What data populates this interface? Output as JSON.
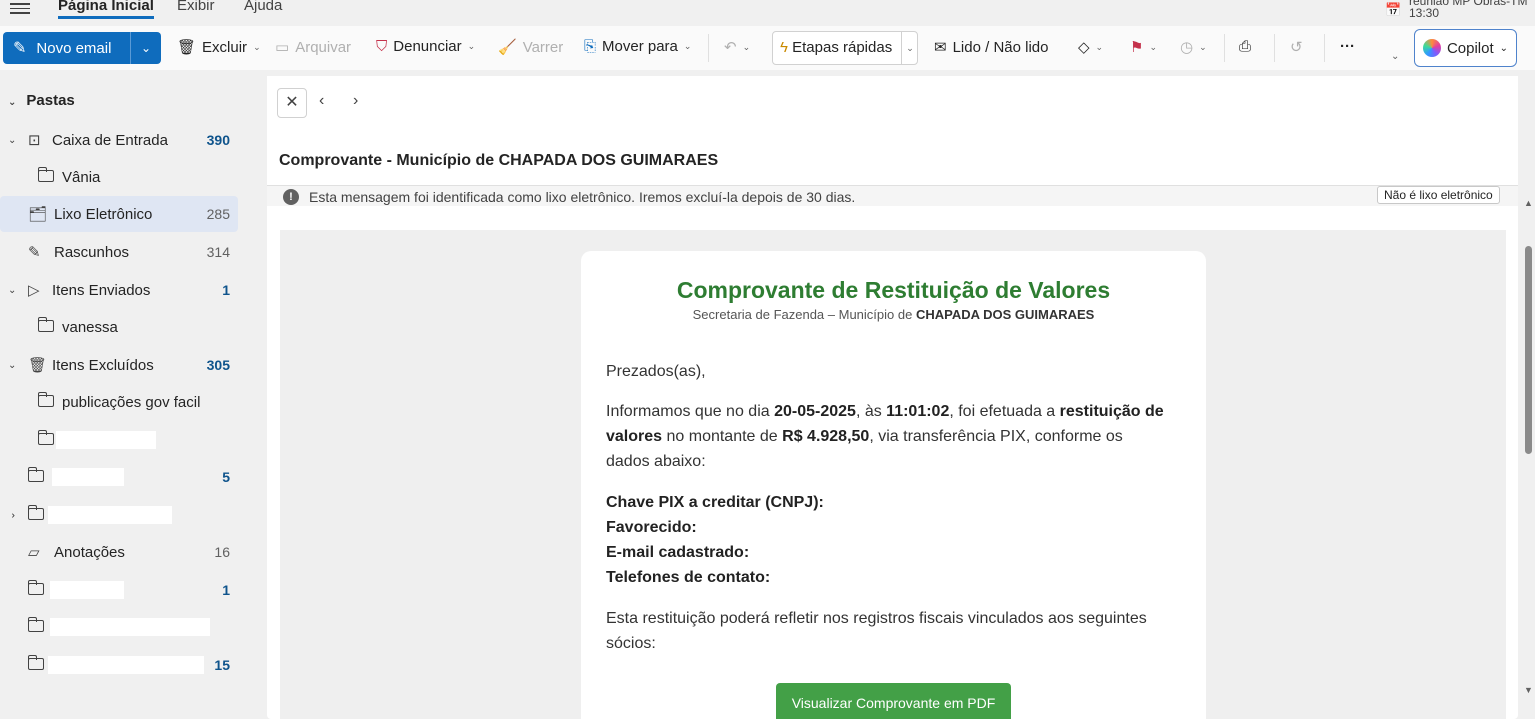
{
  "tabs": [
    {
      "label": "Página Inicial",
      "active": true
    },
    {
      "label": "Exibir",
      "active": false
    },
    {
      "label": "Ajuda",
      "active": false
    }
  ],
  "meeting": {
    "title": "reunião MP Obras-TM",
    "time": "13:30"
  },
  "ribbon": {
    "new_mail": "Novo email",
    "delete": "Excluir",
    "archive": "Arquivar",
    "report": "Denunciar",
    "sweep": "Varrer",
    "move_to": "Mover para",
    "quick_steps": "Etapas rápidas",
    "read_unread": "Lido / Não lido",
    "more": "···",
    "copilot": "Copilot"
  },
  "sidebar": {
    "header": "Pastas",
    "folders": [
      {
        "name": "Caixa de Entrada",
        "count": "390"
      },
      {
        "name": "Vânia",
        "count": ""
      },
      {
        "name": "Lixo Eletrônico",
        "count": "285"
      },
      {
        "name": "Rascunhos",
        "count": "314"
      },
      {
        "name": "Itens Enviados",
        "count": "1"
      },
      {
        "name": "vanessa",
        "count": ""
      },
      {
        "name": "Itens Excluídos",
        "count": "305"
      },
      {
        "name": "publicações gov facil",
        "count": ""
      },
      {
        "name": "",
        "count": ""
      },
      {
        "name": "",
        "count": "5"
      },
      {
        "name": "",
        "count": ""
      },
      {
        "name": "Anotações",
        "count": "16"
      },
      {
        "name": "",
        "count": "1"
      },
      {
        "name": "",
        "count": ""
      },
      {
        "name": "",
        "count": "15"
      }
    ]
  },
  "message": {
    "subject": "Comprovante - Município de CHAPADA DOS GUIMARAES",
    "junk_notice": "Esta mensagem foi identificada como lixo eletrônico. Iremos excluí-la depois de 30 dias.",
    "not_junk": "Não é lixo eletrônico",
    "title": "Comprovante de Restituição de Valores",
    "subtitle_prefix": "Secretaria de Fazenda – Município de ",
    "subtitle_city": "CHAPADA DOS GUIMARAES",
    "greeting": "Prezados(as),",
    "p1_a": "Informamos que no dia ",
    "p1_date": "20-05-2025",
    "p1_b": ", às ",
    "p1_time": "11:01:02",
    "p1_c": ", foi efetuada a ",
    "p1_bold": "restituição de valores",
    "p1_d": " no montante de ",
    "p1_amount": "R$ 4.928,50",
    "p1_e": ", via transferência PIX, conforme os dados abaixo:",
    "field_pix": "Chave PIX a creditar (CNPJ):",
    "field_favorecido": "Favorecido:",
    "field_email": "E-mail cadastrado:",
    "field_phones": "Telefones de contato:",
    "p2": "Esta restituição poderá refletir nos registros fiscais vinculados aos seguintes sócios:",
    "pdf_button": "Visualizar Comprovante em PDF"
  }
}
